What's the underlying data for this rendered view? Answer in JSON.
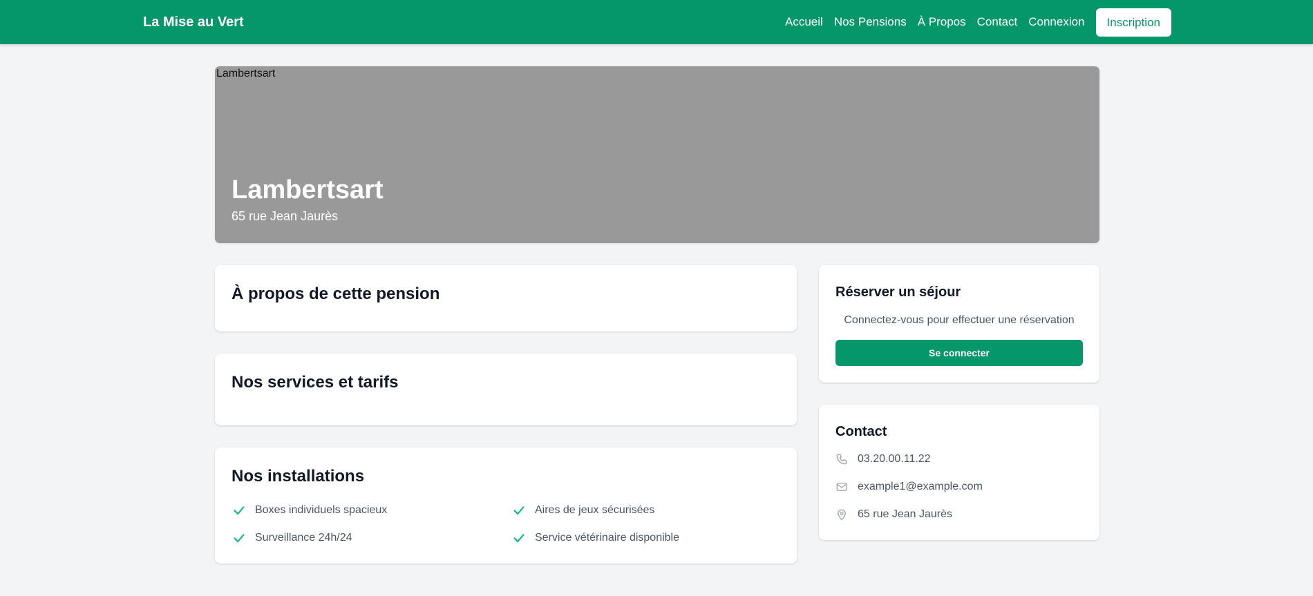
{
  "navbar": {
    "brand": "La Mise au Vert",
    "links": [
      "Accueil",
      "Nos Pensions",
      "À Propos",
      "Contact",
      "Connexion"
    ],
    "cta": "Inscription"
  },
  "hero": {
    "image_alt": "Lambertsart",
    "title": "Lambertsart",
    "subtitle": "65 rue Jean Jaurès"
  },
  "about": {
    "title": "À propos de cette pension"
  },
  "services": {
    "title": "Nos services et tarifs"
  },
  "installations": {
    "title": "Nos installations",
    "features": [
      "Boxes individuels spacieux",
      "Aires de jeux sécurisées",
      "Surveillance 24h/24",
      "Service vétérinaire disponible"
    ]
  },
  "reserve": {
    "title": "Réserver un séjour",
    "text": "Connectez-vous pour effectuer une réservation",
    "button": "Se connecter"
  },
  "contact": {
    "title": "Contact",
    "phone": "03.20.00.11.22",
    "email": "example1@example.com",
    "address": "65 rue Jean Jaurès"
  },
  "colors": {
    "primary": "#059669",
    "background": "#f3f4f6",
    "hero_placeholder": "#999999"
  },
  "icons": {
    "feature": "check-icon",
    "phone": "phone-icon",
    "email": "mail-icon",
    "address": "map-pin-icon"
  }
}
